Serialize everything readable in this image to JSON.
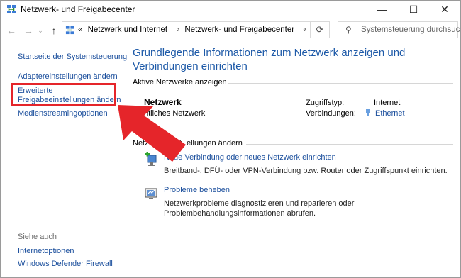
{
  "window": {
    "title": "Netzwerk- und Freigabecenter",
    "minimize": "—",
    "maximize": "☐",
    "close": "✕"
  },
  "nav": {
    "breadcrumbs": [
      "Netzwerk und Internet",
      "Netzwerk- und Freigabecenter"
    ],
    "crumb_prefix": "«",
    "search_placeholder": "Systemsteuerung durchsuch..."
  },
  "sidebar": {
    "items": [
      {
        "label": "Startseite der Systemsteuerung"
      },
      {
        "label": "Adaptereinstellungen ändern"
      },
      {
        "label": "Erweiterte Freigabeeinstellungen ändern",
        "line1": "Erweiterte",
        "line2": "Freigabeeinstellungen ändern"
      },
      {
        "label": "Medienstreamingoptionen"
      }
    ],
    "see_also": "Siehe auch",
    "see_also_items": [
      {
        "label": "Internetoptionen"
      },
      {
        "label": "Windows Defender Firewall"
      }
    ]
  },
  "main": {
    "title": "Grundlegende Informationen zum Netzwerk anzeigen und Verbindungen einrichten",
    "active_networks_label": "Aktive Netzwerke anzeigen",
    "network": {
      "name": "Netzwerk",
      "type": "Öffentliches Netzwerk",
      "type_visible": "ntliches Netzwerk",
      "access_type_label": "Zugriffstyp:",
      "access_type_value": "Internet",
      "connections_label": "Verbindungen:",
      "connections_value": "Ethernet"
    },
    "change_settings_label": "Netzwerkeinstellungen ändern",
    "change_settings_visible": "Netzwerkeinst",
    "change_settings_visible_end": "ellungen ändern",
    "tasks": [
      {
        "title": "Neue Verbindung oder neues Netzwerk einrichten",
        "desc": "Breitband-, DFÜ- oder VPN-Verbindung bzw. Router oder Zugriffspunkt einrichten."
      },
      {
        "title": "Probleme beheben",
        "desc": "Netzwerkprobleme diagnostizieren und reparieren oder Problembehandlungsinformationen abrufen."
      }
    ]
  },
  "colors": {
    "link": "#1a4e9c",
    "title": "#1e5aa8",
    "annotation": "#e5252a"
  }
}
